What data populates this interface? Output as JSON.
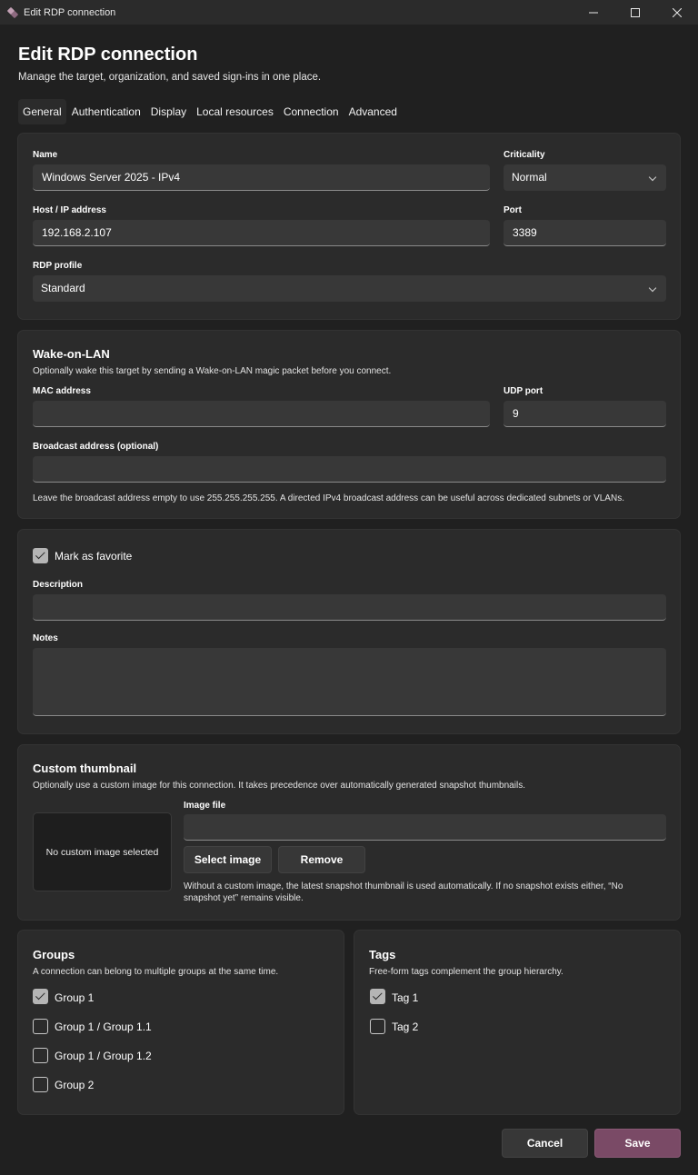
{
  "window": {
    "title": "Edit RDP connection",
    "controls": [
      "minimize",
      "maximize",
      "close"
    ]
  },
  "header": {
    "title": "Edit RDP connection",
    "subtitle": "Manage the target, organization, and saved sign-ins in one place."
  },
  "tabs": [
    {
      "label": "General",
      "active": true
    },
    {
      "label": "Authentication",
      "active": false
    },
    {
      "label": "Display",
      "active": false
    },
    {
      "label": "Local resources",
      "active": false
    },
    {
      "label": "Connection",
      "active": false
    },
    {
      "label": "Advanced",
      "active": false
    }
  ],
  "general": {
    "name_label": "Name",
    "name_value": "Windows Server 2025 - IPv4",
    "criticality_label": "Criticality",
    "criticality_value": "Normal",
    "host_label": "Host / IP address",
    "host_value": "192.168.2.107",
    "port_label": "Port",
    "port_value": "3389",
    "profile_label": "RDP profile",
    "profile_value": "Standard"
  },
  "wol": {
    "title": "Wake-on-LAN",
    "description": "Optionally wake this target by sending a Wake-on-LAN magic packet before you connect.",
    "mac_label": "MAC address",
    "mac_value": "",
    "udp_label": "UDP port",
    "udp_value": "9",
    "broadcast_label": "Broadcast address (optional)",
    "broadcast_value": "",
    "note": "Leave the broadcast address empty to use 255.255.255.255. A directed IPv4 broadcast address can be useful across dedicated subnets or VLANs."
  },
  "meta": {
    "favorite_label": "Mark as favorite",
    "favorite_checked": true,
    "description_label": "Description",
    "description_value": "",
    "notes_label": "Notes",
    "notes_value": ""
  },
  "thumbnail": {
    "title": "Custom thumbnail",
    "description": "Optionally use a custom image for this connection. It takes precedence over automatically generated snapshot thumbnails.",
    "preview_text": "No custom image selected",
    "image_label": "Image file",
    "image_value": "",
    "select_label": "Select image",
    "remove_label": "Remove",
    "note": "Without a custom image, the latest snapshot thumbnail is used automatically. If no snapshot exists either, “No snapshot yet” remains visible."
  },
  "groups": {
    "title": "Groups",
    "description": "A connection can belong to multiple groups at the same time.",
    "items": [
      {
        "label": "Group 1",
        "checked": true
      },
      {
        "label": "Group 1 / Group 1.1",
        "checked": false
      },
      {
        "label": "Group 1 / Group 1.2",
        "checked": false
      },
      {
        "label": "Group 2",
        "checked": false
      }
    ]
  },
  "tags": {
    "title": "Tags",
    "description": "Free-form tags complement the group hierarchy.",
    "items": [
      {
        "label": "Tag 1",
        "checked": true
      },
      {
        "label": "Tag 2",
        "checked": false
      }
    ]
  },
  "footer": {
    "cancel_label": "Cancel",
    "save_label": "Save"
  },
  "colors": {
    "background": "#202020",
    "card": "#2b2b2b",
    "input": "#383838",
    "accent": "#7a4a66"
  }
}
